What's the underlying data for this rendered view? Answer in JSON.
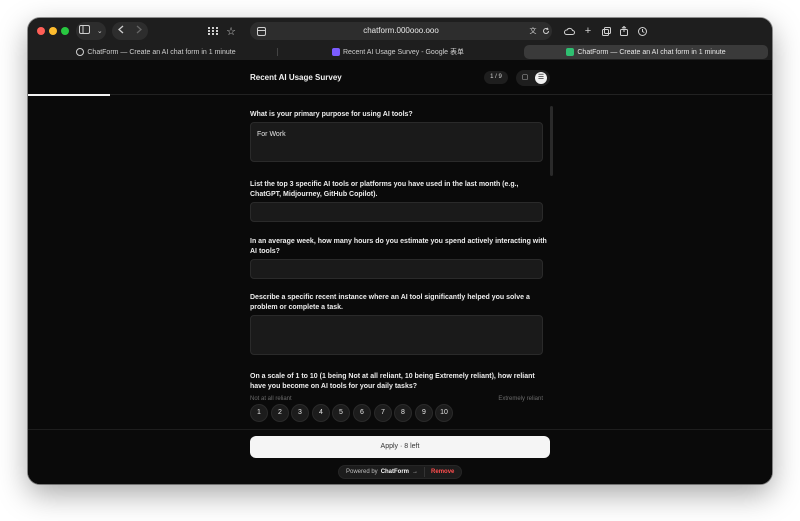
{
  "browser": {
    "address": "chatform.000ooo.ooo",
    "tabs": [
      {
        "label": "ChatForm — Create an AI chat form in 1 minute",
        "favicon_color": "#d0d0d0",
        "active": false
      },
      {
        "label": "Recent AI Usage Survey - Google 表单",
        "favicon_color": "#7b5cff",
        "active": false
      },
      {
        "label": "ChatForm — Create an AI chat form in 1 minute",
        "favicon_color": "#2fbf71",
        "active": true
      }
    ]
  },
  "header": {
    "title": "Recent AI Usage Survey",
    "page_counter": "1 / 9",
    "progress": 0.11
  },
  "questions": [
    {
      "label": "What is your primary purpose for using AI tools?",
      "value": "For Work"
    },
    {
      "label": "List the top 3 specific AI tools or platforms you have used in the last month (e.g., ChatGPT, Midjourney, GitHub Copilot).",
      "value": ""
    },
    {
      "label": "In an average week, how many hours do you estimate you spend actively interacting with AI tools?",
      "value": ""
    },
    {
      "label": "Describe a specific recent instance where an AI tool significantly helped you solve a problem or complete a task.",
      "value": ""
    },
    {
      "label": "On a scale of 1 to 10 (1 being Not at all reliant, 10 being Extremely reliant), how reliant have you become on AI tools for your daily tasks?",
      "value": ""
    }
  ],
  "scale": {
    "min_label": "Not at all reliant",
    "max_label": "Extremely reliant",
    "options": [
      "1",
      "2",
      "3",
      "4",
      "5",
      "6",
      "7",
      "8",
      "9",
      "10"
    ]
  },
  "footer": {
    "apply_label": "Apply · 8 left",
    "powered_by": "Powered by",
    "brand": "ChatForm",
    "arrow": "→",
    "remove": "Remove"
  },
  "colors": {
    "window_bg": "#0a0a0a",
    "accent_remove": "#ff4d4d"
  }
}
